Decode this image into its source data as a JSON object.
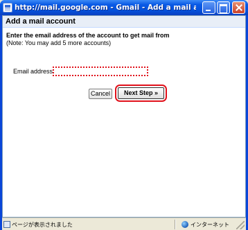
{
  "window": {
    "title": "http://mail.google.com - Gmail - Add a mail account - Microsoft In..."
  },
  "dialog": {
    "title": "Add a mail account",
    "instruction": "Enter the email address of the account to get mail from",
    "note": "(Note: You may add 5 more accounts)",
    "email_label": "Email address:",
    "email_value": "",
    "cancel_label": "Cancel",
    "next_label": "Next Step »"
  },
  "statusbar": {
    "status_text": "ページが表示されました",
    "zone_text": "インターネット"
  },
  "colors": {
    "highlight": "#e0101a",
    "titlebar": "#0a5ae5",
    "header_bg": "#e8eef7"
  }
}
